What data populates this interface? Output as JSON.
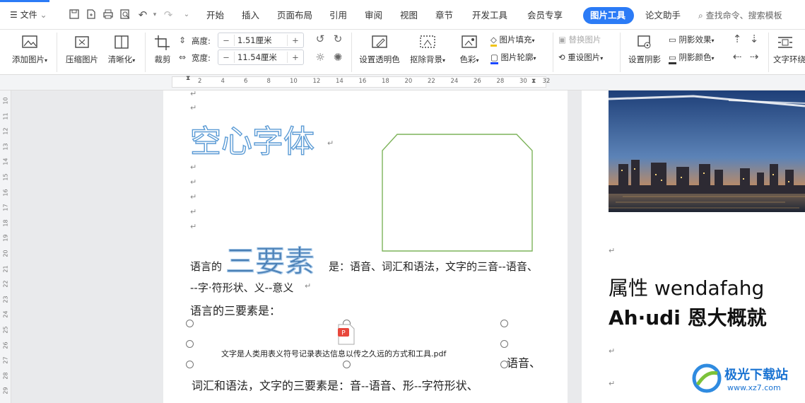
{
  "file_menu": {
    "label": "文件"
  },
  "tabs": [
    {
      "label": "开始"
    },
    {
      "label": "插入"
    },
    {
      "label": "页面布局"
    },
    {
      "label": "引用"
    },
    {
      "label": "审阅"
    },
    {
      "label": "视图"
    },
    {
      "label": "章节"
    },
    {
      "label": "开发工具"
    },
    {
      "label": "会员专享"
    },
    {
      "label": "图片工具"
    },
    {
      "label": "论文助手"
    }
  ],
  "search": {
    "placeholder": "查找命令、搜索模板"
  },
  "ribbon": {
    "add_image": "添加图片",
    "compress_image": "压缩图片",
    "clarify": "清晰化",
    "crop": "裁剪",
    "height_label": "高度:",
    "height_value": "1.51厘米",
    "width_label": "宽度:",
    "width_value": "11.54厘米",
    "set_transparent": "设置透明色",
    "remove_bg": "抠除背景",
    "color": "色彩",
    "image_fill": "图片填充",
    "image_outline": "图片轮廓",
    "replace_image": "替换图片",
    "reset_image": "重设图片",
    "set_shadow": "设置阴影",
    "shadow_effect": "阴影效果",
    "shadow_color": "阴影颜色",
    "text_wrap": "文字环绕"
  },
  "ruler": {
    "h_ticks": [
      "2",
      "4",
      "6",
      "8",
      "10",
      "12",
      "14",
      "16",
      "18",
      "20",
      "22",
      "24",
      "26",
      "28",
      "30",
      "32"
    ],
    "v_ticks": [
      "10",
      "11",
      "12",
      "13",
      "14",
      "15",
      "16",
      "17",
      "18",
      "19",
      "20",
      "21",
      "22",
      "23",
      "24",
      "25",
      "26",
      "27",
      "28",
      "29"
    ]
  },
  "document": {
    "paragraph_mark": "↵",
    "hollow_title": "空心字体",
    "line1_prefix": "语言的",
    "line1_big": "三要素",
    "line1_suffix": "是：语音、词汇和语法，文字的三音--语音、",
    "line2": "--字·符形状、义--意义",
    "line3": "语言的三要素是：",
    "pdf_name": "文字是人类用表义符号记录表达信息以传之久远的方式和工具.pdf",
    "line4_tail": "语音、",
    "line5": "词汇和语法，文字的三要素是：音--语音、形--字符形状、",
    "right_line1": "属性 wendafahg",
    "right_line2": "Ah·udi 恩大概就"
  },
  "watermark": {
    "name": "极光下载站",
    "url": "www.xz7.com"
  }
}
